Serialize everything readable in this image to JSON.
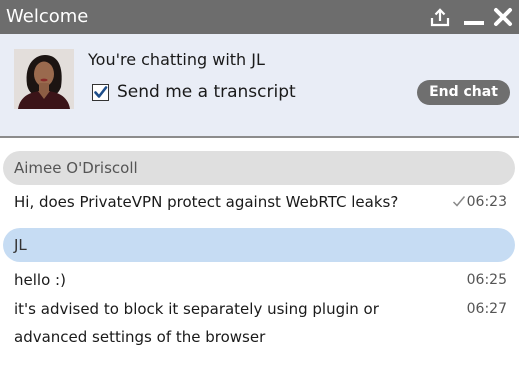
{
  "window": {
    "title": "Welcome"
  },
  "header": {
    "chatting_with": "You're chatting with JL",
    "transcript_label": "Send me a transcript",
    "transcript_checked": true,
    "end_chat_label": "End chat"
  },
  "chat": {
    "visitor_name": "Aimee O'Driscoll",
    "agent_name": "JL",
    "messages": [
      {
        "text": "Hi, does PrivateVPN protect against WebRTC leaks?",
        "time": "06:23",
        "delivered": true
      },
      {
        "text": "hello :)",
        "time": "06:25"
      },
      {
        "text": "it's advised to block it separately using plugin or advanced settings of the browser",
        "time": "06:27"
      }
    ]
  },
  "colors": {
    "titlebar": "#6d6d6d",
    "header_bg": "#e9edf6",
    "visitor_bubble": "#dfdfdf",
    "agent_bubble": "#c6dcf3",
    "end_chat_button": "#6f6f6f"
  },
  "icons": {
    "popout": "popout-icon",
    "minimize": "minimize-icon",
    "close": "close-icon",
    "delivered": "check-icon"
  }
}
